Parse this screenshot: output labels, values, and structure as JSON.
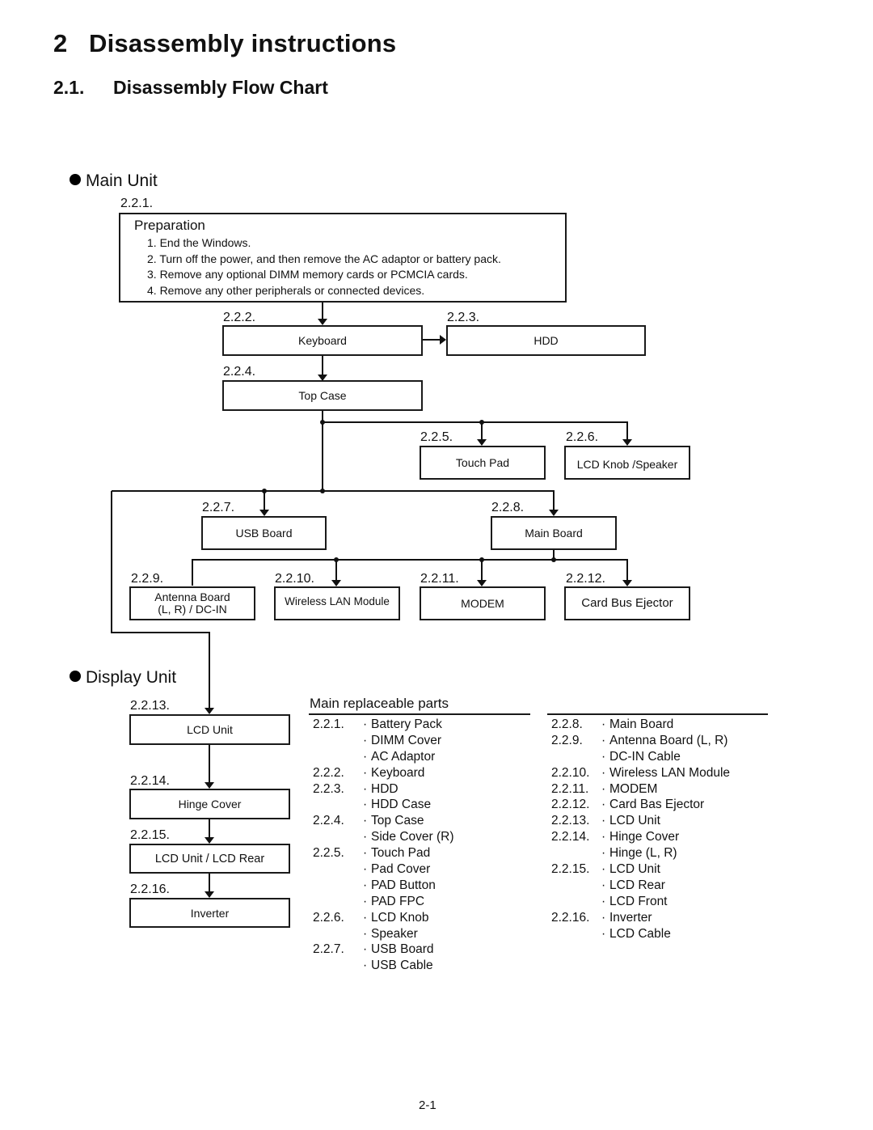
{
  "heading": {
    "number": "2",
    "title": "Disassembly instructions"
  },
  "subheading": {
    "number": "2.1.",
    "title": "Disassembly Flow Chart"
  },
  "main_unit": {
    "label": "Main Unit",
    "preparation": {
      "step": "2.2.1.",
      "title": "Preparation",
      "items": [
        "1. End the Windows.",
        "2. Turn off the power, and then remove the AC adaptor or battery pack.",
        "3. Remove any optional DIMM memory cards or PCMCIA cards.",
        "4. Remove any other peripherals or connected devices."
      ]
    },
    "steps": [
      {
        "step": "2.2.2.",
        "label": "Keyboard"
      },
      {
        "step": "2.2.3.",
        "label": "HDD"
      },
      {
        "step": "2.2.4.",
        "label": "Top Case"
      },
      {
        "step": "2.2.5.",
        "label": "Touch Pad"
      },
      {
        "step": "2.2.6.",
        "label": "LCD Knob /Speaker"
      },
      {
        "step": "2.2.7.",
        "label": "USB Board"
      },
      {
        "step": "2.2.8.",
        "label": "Main Board"
      },
      {
        "step": "2.2.9.",
        "label": "Antenna Board\n(L, R) / DC-IN"
      },
      {
        "step": "2.2.10.",
        "label": "Wireless LAN Module"
      },
      {
        "step": "2.2.11.",
        "label": "MODEM"
      },
      {
        "step": "2.2.12.",
        "label": "Card Bus Ejector"
      }
    ]
  },
  "display_unit": {
    "label": "Display Unit",
    "steps": [
      {
        "step": "2.2.13.",
        "label": "LCD Unit"
      },
      {
        "step": "2.2.14.",
        "label": "Hinge Cover"
      },
      {
        "step": "2.2.15.",
        "label": "LCD Unit / LCD Rear"
      },
      {
        "step": "2.2.16.",
        "label": "Inverter"
      }
    ]
  },
  "parts": {
    "title": "Main replaceable parts",
    "bullet": "・",
    "left": [
      {
        "code": "2.2.1.",
        "part": "Battery Pack"
      },
      {
        "code": "",
        "part": "DIMM Cover"
      },
      {
        "code": "",
        "part": "AC Adaptor"
      },
      {
        "code": "2.2.2.",
        "part": "Keyboard"
      },
      {
        "code": "2.2.3.",
        "part": "HDD"
      },
      {
        "code": "",
        "part": "HDD Case"
      },
      {
        "code": "2.2.4.",
        "part": "Top Case"
      },
      {
        "code": "",
        "part": "Side Cover (R)"
      },
      {
        "code": "2.2.5.",
        "part": "Touch Pad"
      },
      {
        "code": "",
        "part": "Pad Cover"
      },
      {
        "code": "",
        "part": "PAD Button"
      },
      {
        "code": "",
        "part": "PAD FPC"
      },
      {
        "code": "2.2.6.",
        "part": "LCD Knob"
      },
      {
        "code": "",
        "part": "Speaker"
      },
      {
        "code": "2.2.7.",
        "part": "USB Board"
      },
      {
        "code": "",
        "part": "USB Cable"
      }
    ],
    "right": [
      {
        "code": "2.2.8.",
        "part": "Main Board"
      },
      {
        "code": "2.2.9.",
        "part": "Antenna Board (L, R)"
      },
      {
        "code": "",
        "part": "DC-IN Cable"
      },
      {
        "code": "2.2.10.",
        "part": "Wireless LAN Module"
      },
      {
        "code": "2.2.11.",
        "part": "MODEM"
      },
      {
        "code": "2.2.12.",
        "part": "Card Bas Ejector"
      },
      {
        "code": "2.2.13.",
        "part": "LCD Unit"
      },
      {
        "code": "2.2.14.",
        "part": "Hinge Cover"
      },
      {
        "code": "",
        "part": "Hinge (L, R)"
      },
      {
        "code": "2.2.15.",
        "part": "LCD Unit"
      },
      {
        "code": "",
        "part": "LCD Rear"
      },
      {
        "code": "",
        "part": "LCD Front"
      },
      {
        "code": "2.2.16.",
        "part": "Inverter"
      },
      {
        "code": "",
        "part": "LCD Cable"
      }
    ]
  },
  "footer": {
    "page_number": "2-1"
  }
}
